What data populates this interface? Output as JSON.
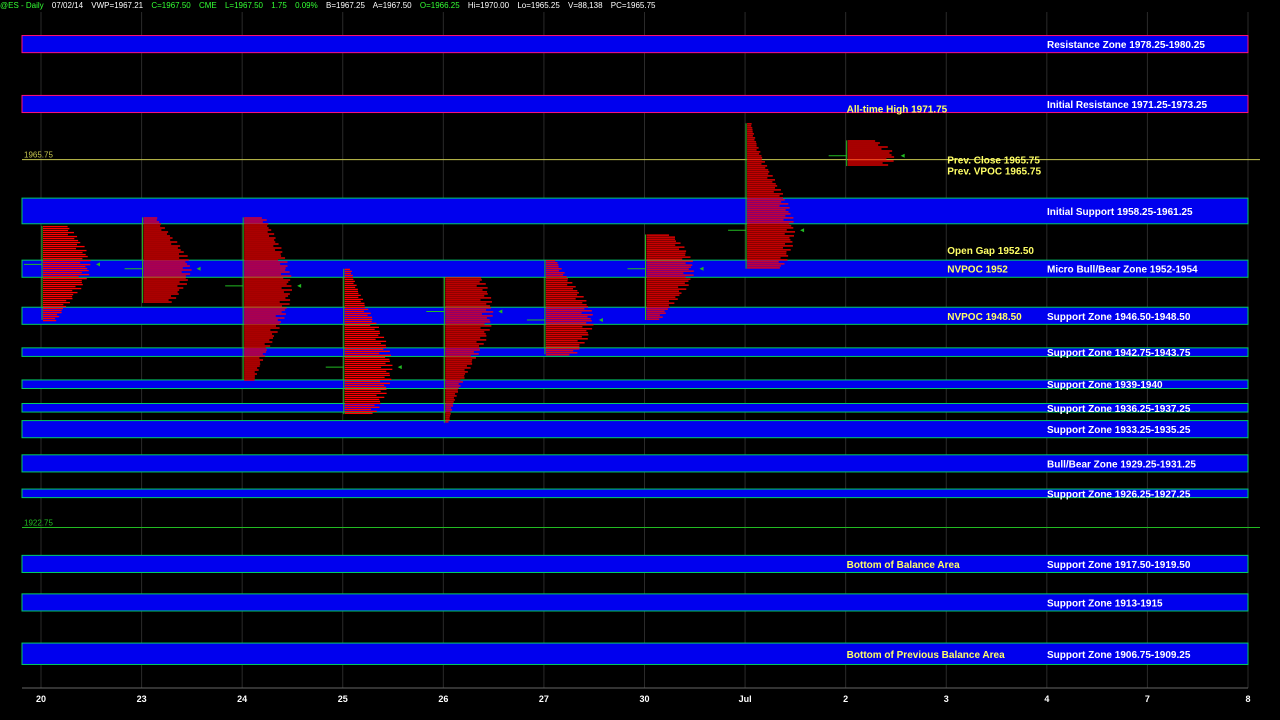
{
  "header": {
    "symbol": "@ES - Daily",
    "date": "07/02/14",
    "vwp": "VWP=1967.21",
    "close": "C=1967.50",
    "exchange": "CME",
    "last": "L=1967.50",
    "change": "1.75",
    "pct": "0.09%",
    "bid": "B=1967.25",
    "ask": "A=1967.50",
    "open": "O=1966.25",
    "high": "Hi=1970.00",
    "low": "Lo=1965.25",
    "volume": "V=88,138",
    "prev_close": "PC=1965.75"
  },
  "colors": {
    "zone_fill": "#0000ee",
    "zone_border_support": "#00cc66",
    "zone_border_resistance": "#ff1177",
    "profile": "#ff0000",
    "label_yellow": "#ffff66",
    "label_white": "#ffffff",
    "price_line": "#c8c850",
    "green_line": "#22bb22"
  },
  "chart_data": {
    "type": "volume-profile",
    "title": "",
    "ylim": [
      1904,
      1983
    ],
    "x_ticks": [
      "20",
      "23",
      "24",
      "25",
      "26",
      "27",
      "30",
      "Jul",
      "2",
      "3",
      "4",
      "7",
      "8"
    ],
    "price_markers": [
      {
        "label": "1965.75",
        "price": 1965.75,
        "color": "#c8c850"
      },
      {
        "label": "1922.75",
        "price": 1922.75,
        "color": "#22bb22"
      }
    ],
    "zones": [
      {
        "low": 1978.25,
        "high": 1980.25,
        "label": "Resistance Zone 1978.25-1980.25",
        "kind": "resistance"
      },
      {
        "low": 1971.25,
        "high": 1973.25,
        "label": "Initial Resistance 1971.25-1973.25",
        "kind": "resistance"
      },
      {
        "low": 1958.25,
        "high": 1961.25,
        "label": "Initial Support 1958.25-1961.25",
        "kind": "support"
      },
      {
        "low": 1952,
        "high": 1954,
        "label": "Micro Bull/Bear Zone 1952-1954",
        "kind": "support"
      },
      {
        "low": 1946.5,
        "high": 1948.5,
        "label": "Support Zone 1946.50-1948.50",
        "kind": "support"
      },
      {
        "low": 1942.75,
        "high": 1943.75,
        "label": "Support Zone 1942.75-1943.75",
        "kind": "support"
      },
      {
        "low": 1939,
        "high": 1940,
        "label": "Support Zone 1939-1940",
        "kind": "support"
      },
      {
        "low": 1936.25,
        "high": 1937.25,
        "label": "Support Zone 1936.25-1937.25",
        "kind": "support"
      },
      {
        "low": 1933.25,
        "high": 1935.25,
        "label": "Support Zone 1933.25-1935.25",
        "kind": "support"
      },
      {
        "low": 1929.25,
        "high": 1931.25,
        "label": "Bull/Bear Zone 1929.25-1931.25",
        "kind": "support"
      },
      {
        "low": 1926.25,
        "high": 1927.25,
        "label": "Support Zone 1926.25-1927.25",
        "kind": "support"
      },
      {
        "low": 1917.5,
        "high": 1919.5,
        "label": "Support Zone 1917.50-1919.50",
        "kind": "support"
      },
      {
        "low": 1913,
        "high": 1915,
        "label": "Support Zone 1913-1915",
        "kind": "support"
      },
      {
        "low": 1906.75,
        "high": 1909.25,
        "label": "Support Zone 1906.75-1909.25",
        "kind": "support"
      }
    ],
    "annotations": [
      {
        "text": "All-time High 1971.75",
        "price": 1971.75,
        "column": 8
      },
      {
        "text": "Prev. Close 1965.75",
        "price": 1965.75,
        "column": 9
      },
      {
        "text": "Prev. VPOC 1965.75",
        "price": 1964.5,
        "column": 9
      },
      {
        "text": "Open Gap 1952.50",
        "price": 1955.2,
        "column": 9
      },
      {
        "text": "NVPOC 1952",
        "price": 1953,
        "column": 9
      },
      {
        "text": "NVPOC 1948.50",
        "price": 1947.5,
        "column": 9
      },
      {
        "text": "Bottom of Balance Area",
        "price": 1918.5,
        "column": 8
      },
      {
        "text": "Bottom of Previous Balance Area",
        "price": 1908,
        "column": 8
      }
    ],
    "profiles": [
      {
        "day": "20",
        "low": 1947,
        "high": 1958,
        "poc": 1953.5
      },
      {
        "day": "23",
        "low": 1949,
        "high": 1959,
        "poc": 1953.0
      },
      {
        "day": "24",
        "low": 1940,
        "high": 1959,
        "poc": 1951.0
      },
      {
        "day": "25",
        "low": 1936,
        "high": 1953,
        "poc": 1941.5
      },
      {
        "day": "26",
        "low": 1935,
        "high": 1952,
        "poc": 1948.0
      },
      {
        "day": "27",
        "low": 1943,
        "high": 1954,
        "poc": 1947.0
      },
      {
        "day": "30",
        "low": 1947,
        "high": 1957,
        "poc": 1953.0
      },
      {
        "day": "Jul",
        "low": 1953,
        "high": 1970,
        "poc": 1957.5
      },
      {
        "day": "2",
        "low": 1965,
        "high": 1968,
        "poc": 1966.2
      }
    ]
  }
}
